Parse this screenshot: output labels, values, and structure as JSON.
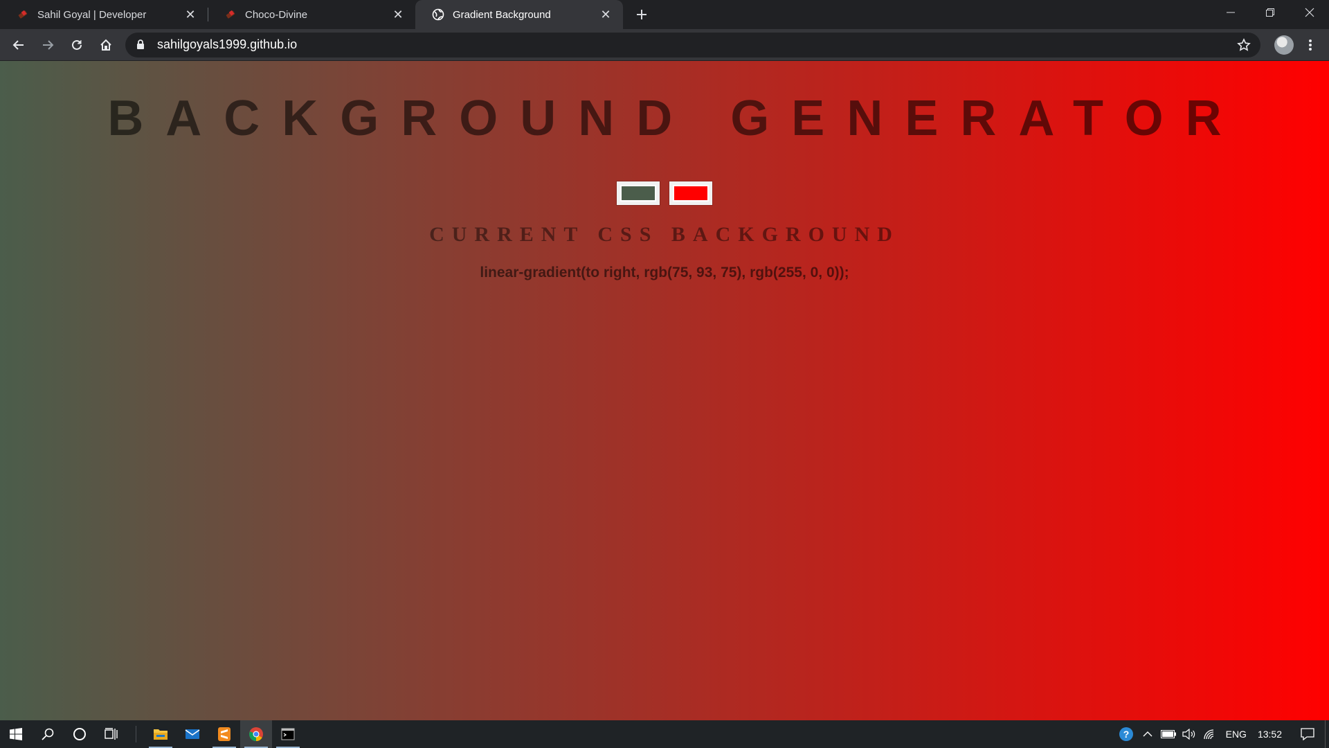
{
  "browser": {
    "tabs": [
      {
        "title": "Sahil Goyal | Developer",
        "favicon": "chocolate-icon",
        "active": false
      },
      {
        "title": "Choco-Divine",
        "favicon": "chocolate-icon",
        "active": false
      },
      {
        "title": "Gradient Background",
        "favicon": "globe-icon",
        "active": true
      }
    ],
    "url": "sahilgoyals1999.github.io"
  },
  "page": {
    "title": "BACKGROUND GENERATOR",
    "subtitle": "CURRENT CSS BACKGROUND",
    "css_output": "linear-gradient(to right, rgb(75, 93, 75), rgb(255, 0, 0));",
    "color1": "#4b5d4b",
    "color2": "#ff0000"
  },
  "taskbar": {
    "apps": [
      "file-explorer-icon",
      "mail-icon",
      "sublime-text-icon",
      "chrome-icon",
      "terminal-icon"
    ],
    "tray": {
      "language": "ENG",
      "time": "13:52"
    }
  }
}
